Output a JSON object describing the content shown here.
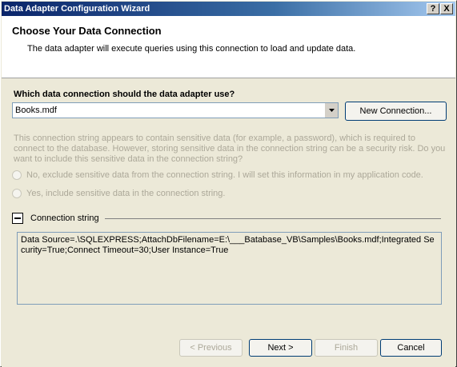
{
  "window": {
    "title": "Data Adapter Configuration Wizard",
    "help_glyph": "?",
    "close_glyph": "X"
  },
  "header": {
    "title": "Choose Your Data Connection",
    "description": "The data adapter will execute queries using this connection to load and update data."
  },
  "connection": {
    "question": "Which data connection should the data adapter use?",
    "selected": "Books.mdf",
    "new_connection_label": "New Connection..."
  },
  "sensitive": {
    "warning": "This connection string appears to contain sensitive data (for example, a password), which is required to connect to the database. However, storing sensitive data in the connection string can be a security risk. Do you want to include this sensitive data in the connection string?",
    "option_no": "No, exclude sensitive data from the connection string. I will set this information in my application code.",
    "option_yes": "Yes, include sensitive data in the connection string."
  },
  "connection_string": {
    "section_label": "Connection string",
    "value": "Data Source=.\\SQLEXPRESS;AttachDbFilename=E:\\___Batabase_VB\\Samples\\Books.mdf;Integrated Security=True;Connect Timeout=30;User Instance=True"
  },
  "footer": {
    "previous_label": "< Previous",
    "next_label": "Next >",
    "finish_label": "Finish",
    "cancel_label": "Cancel"
  }
}
